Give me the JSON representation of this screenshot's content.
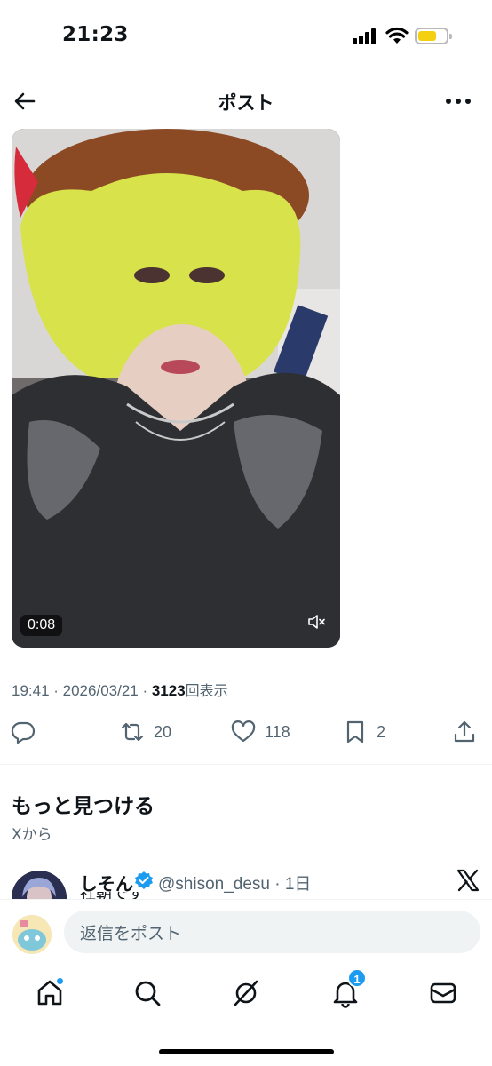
{
  "status_bar": {
    "time": "21:23"
  },
  "header": {
    "title": "ポスト"
  },
  "media": {
    "duration": "0:08"
  },
  "meta": {
    "timestamp": "19:41 · 2026/03/21 · ",
    "views_count": "3123",
    "views_label": "回表示"
  },
  "actions": {
    "retweets": "20",
    "likes": "118",
    "bookmarks": "2"
  },
  "discover": {
    "title": "もっと見つける",
    "subtitle": "Xから"
  },
  "suggested_post": {
    "name": "しそん",
    "handle_time": "@shison_desu · 1日",
    "text_partial": "社朝です"
  },
  "reply": {
    "placeholder": "返信をポスト"
  },
  "nav": {
    "notifications_badge": "1"
  },
  "colors": {
    "accent": "#1d9bf0",
    "muted": "#536471",
    "text": "#0f1419"
  }
}
